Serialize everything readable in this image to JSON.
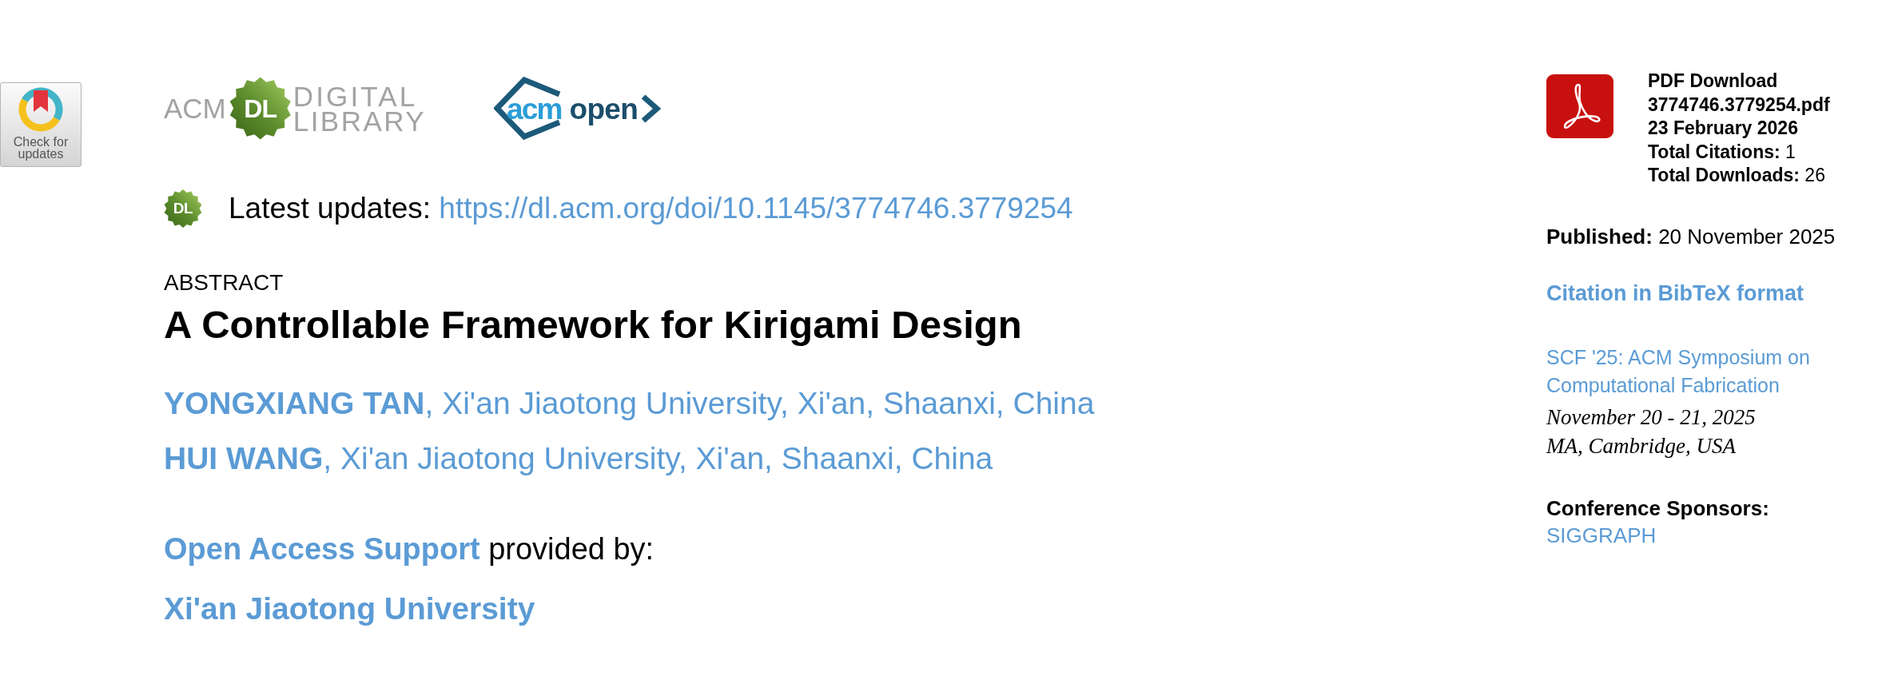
{
  "check_for_updates": {
    "label": "Check for updates"
  },
  "logos": {
    "acm_dl": {
      "acm": "ACM",
      "badge": "DL",
      "line_1": "DIGITAL",
      "line_2": "LIBRARY"
    },
    "acm_open": {
      "acm": "acm",
      "open": "open"
    }
  },
  "latest_updates": {
    "badge": "DL",
    "label": "Latest updates:",
    "url": "https://dl.acm.org/doi/10.1145/3774746.3779254"
  },
  "article": {
    "section": "ABSTRACT",
    "title": "A Controllable Framework for Kirigami Design",
    "authors": [
      "**YONGXIANG TAN**, Xi'an Jiaotong University, Xi'an, Shaanxi, China",
      "**HUI WANG**, Xi'an Jiaotong University, Xi'an, Shaanxi, China"
    ],
    "open_access": {
      "link": "Open Access Support",
      "text": "provided by:",
      "institution": "Xi'an Jiaotong University"
    }
  },
  "sidebar": {
    "pdf": {
      "heading": "PDF Download",
      "file": "3774746.3779254.pdf",
      "date": "23 February 2026",
      "stats": [
        "**Total Citations:** 1",
        "**Total Downloads:** 26"
      ]
    },
    "published": "**Published:** 20 November 2025",
    "citation_link": "Citation in BibTeX format",
    "conference": {
      "name": "SCF '25: ACM Symposium on Computational Fabrication",
      "dates": "November 20 - 21, 2025",
      "location": "MA, Cambridge, USA"
    },
    "sponsors": {
      "label": "Conference Sponsors:",
      "items": [
        "SIGGRAPH"
      ]
    }
  }
}
